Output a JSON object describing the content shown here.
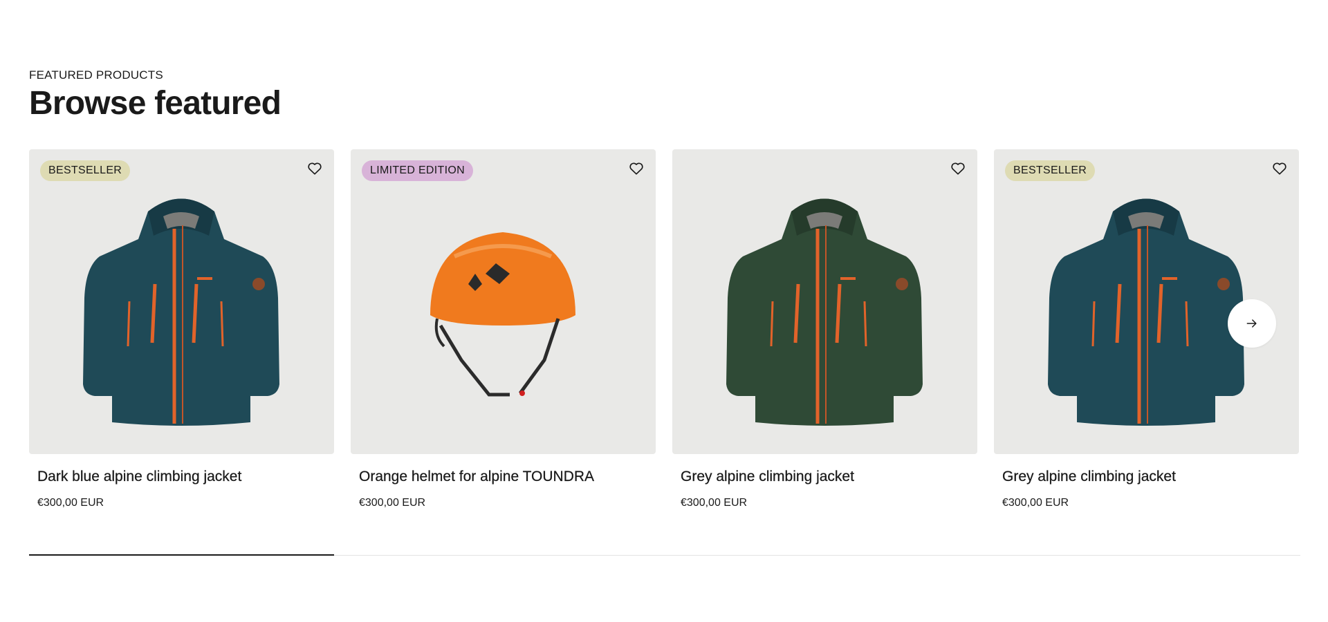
{
  "section": {
    "eyebrow": "FEATURED PRODUCTS",
    "heading": "Browse featured"
  },
  "products": [
    {
      "badge": "BESTSELLER",
      "badge_color": "#dedbb3",
      "title": "Dark blue alpine climbing jacket",
      "price": "€300,00 EUR",
      "image": "jacket-blue"
    },
    {
      "badge": "LIMITED EDITION",
      "badge_color": "#d8b3d8",
      "title": "Orange helmet for alpine TOUNDRA",
      "price": "€300,00 EUR",
      "image": "helmet-orange"
    },
    {
      "badge": "",
      "badge_color": "",
      "title": "Grey alpine climbing jacket",
      "price": "€300,00 EUR",
      "image": "jacket-green"
    },
    {
      "badge": "BESTSELLER",
      "badge_color": "#dedbb3",
      "title": "Grey alpine climbing jacket",
      "price": "€300,00 EUR",
      "image": "jacket-blue"
    }
  ],
  "carousel": {
    "next_icon": "arrow-right-icon",
    "progress": 0.24
  },
  "icons": {
    "favorite": "heart-outline-icon"
  },
  "colors": {
    "card_bg": "#e9e9e7",
    "text": "#1a1a1a"
  }
}
